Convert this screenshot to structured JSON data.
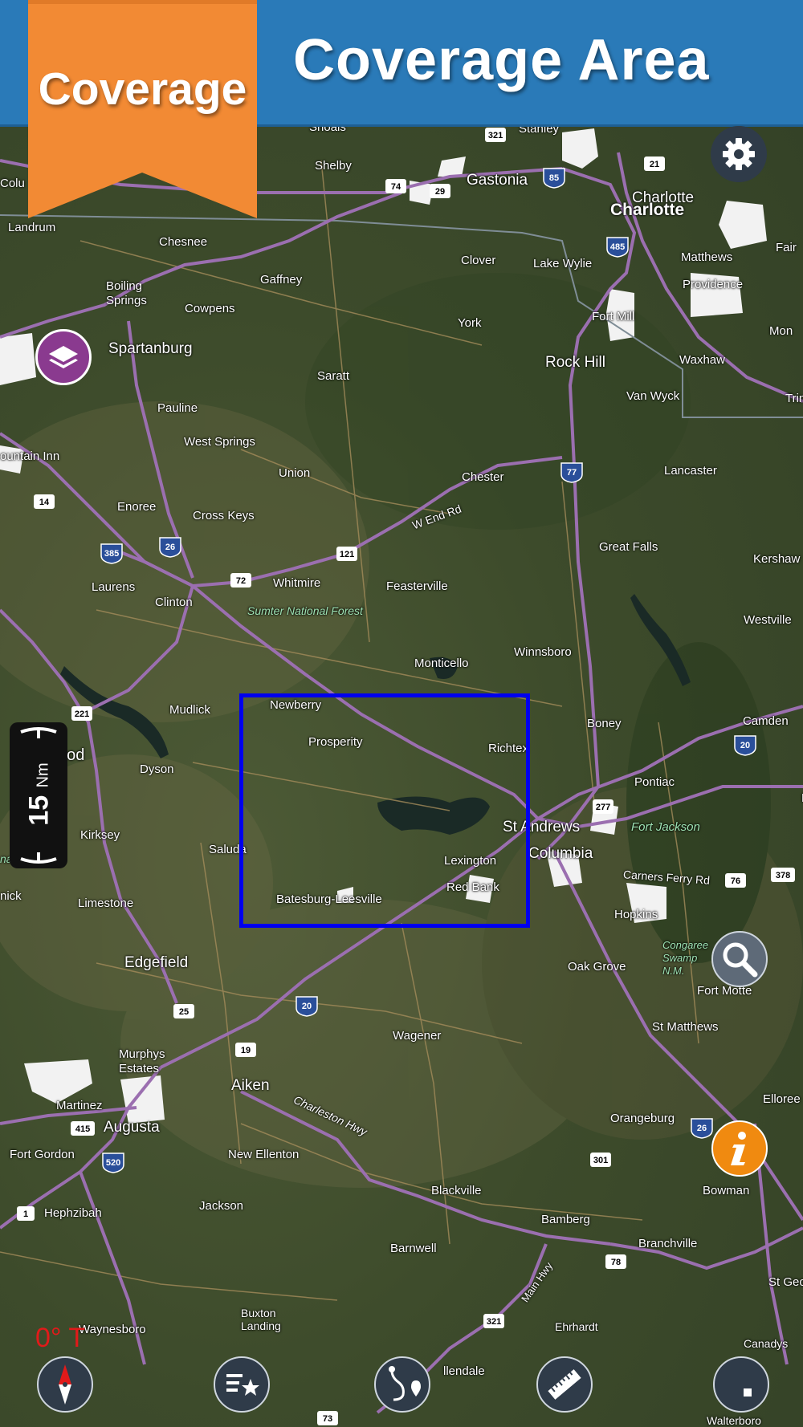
{
  "header": {
    "title": "Coverage Area",
    "badge": "Coverage"
  },
  "scale": {
    "value": "15",
    "unit": "Nm"
  },
  "compass_heading": "0° T",
  "places": {
    "shelby": "Shelby",
    "gastonia": "Gastonia",
    "stanley": "Stanley",
    "charlotte_a": "Charlotte",
    "charlotte_b": "Charlotte",
    "landrum": "Landrum",
    "chesnee": "Chesnee",
    "gaffney": "Gaffney",
    "clover": "Clover",
    "lake_wylie": "Lake Wylie",
    "matthews": "Matthews",
    "boiling_springs": "Boiling\nSprings",
    "cowpens": "Cowpens",
    "providence": "Providence",
    "fort_mill": "Fort Mill",
    "york": "York",
    "spartanburg": "Spartanburg",
    "rock_hill": "Rock Hill",
    "waxhaw": "Waxhaw",
    "saratt": "Saratt",
    "van_wyck": "Van Wyck",
    "pauline": "Pauline",
    "west_springs": "West Springs",
    "union": "Union",
    "chester": "Chester",
    "lancaster": "Lancaster",
    "fountain_inn": "ountain Inn",
    "enoree": "Enoree",
    "cross_keys": "Cross Keys",
    "w_end_rd": "W End Rd",
    "great_falls": "Great Falls",
    "kershaw": "Kershaw",
    "laurens": "Laurens",
    "whitmire": "Whitmire",
    "feasterville": "Feasterville",
    "clinton": "Clinton",
    "sumter_nf": "Sumter National Forest",
    "westville": "Westville",
    "monticello": "Monticello",
    "winnsboro": "Winnsboro",
    "mudlick": "Mudlick",
    "newberry": "Newberry",
    "boney": "Boney",
    "camden": "Camden",
    "prosperity": "Prosperity",
    "richtex": "Richtex",
    "dyson": "Dyson",
    "pontiac": "Pontiac",
    "kirksey": "Kirksey",
    "st_andrews": "St Andrews",
    "fort_jackson": "Fort Jackson",
    "saluda": "Saluda",
    "columbia": "Columbia",
    "lexington": "Lexington",
    "nal_forest": "nal Forest",
    "carners_ferry": "Carners Ferry Rd",
    "limestone": "Limestone",
    "batesburg": "Batesburg-Leesville",
    "red_bank": "Red Bank",
    "hopkins": "Hopkins",
    "congaree": "Congaree\nSwamp\nN.M.",
    "edgefield": "Edgefield",
    "oak_grove": "Oak Grove",
    "fort_motte": "Fort Motte",
    "st_matthews": "St Matthews",
    "wagener": "Wagener",
    "murphys_estates": "Murphys\nEstates",
    "aiken": "Aiken",
    "charleston_hwy": "Charleston Hwy",
    "martinez": "Martinez",
    "augusta": "Augusta",
    "elloree": "Elloree",
    "orangeburg": "Orangeburg",
    "fort_gordon": "Fort Gordon",
    "new_ellenton": "New Ellenton",
    "bowman": "Bowman",
    "blackville": "Blackville",
    "hephzibah": "Hephzibah",
    "jackson": "Jackson",
    "bamberg": "Bamberg",
    "branchville": "Branchville",
    "barnwell": "Barnwell",
    "main_hwy": "Main Hwy",
    "st_george": "St Georg",
    "buxton_landing": "Buxton\nLanding",
    "ehrhardt": "Ehrhardt",
    "waynesboro": "Waynesboro",
    "canadys": "Canadys",
    "allendale": "llendale",
    "fairview": "Fair",
    "monroe": "Mon",
    "trinity": "Trin",
    "col": "Colu",
    "ood": "ood",
    "nick": "nick",
    "walterboro": "Walterboro",
    "shoals": "Shoals"
  },
  "route_shields": [
    "321",
    "85",
    "21",
    "74",
    "29",
    "485",
    "14",
    "385",
    "26",
    "72",
    "121",
    "77",
    "221",
    "20",
    "277",
    "76",
    "378",
    "25",
    "19",
    "415",
    "520",
    "1",
    "301",
    "78",
    "321",
    "73",
    "26"
  ],
  "colors": {
    "banner": "#2a7ab8",
    "ribbon": "#f28a34",
    "selection": "#0000ee",
    "interstate": "#9b6fb0",
    "layers_button": "#8a3a8f",
    "info_button": "#f08a10"
  }
}
